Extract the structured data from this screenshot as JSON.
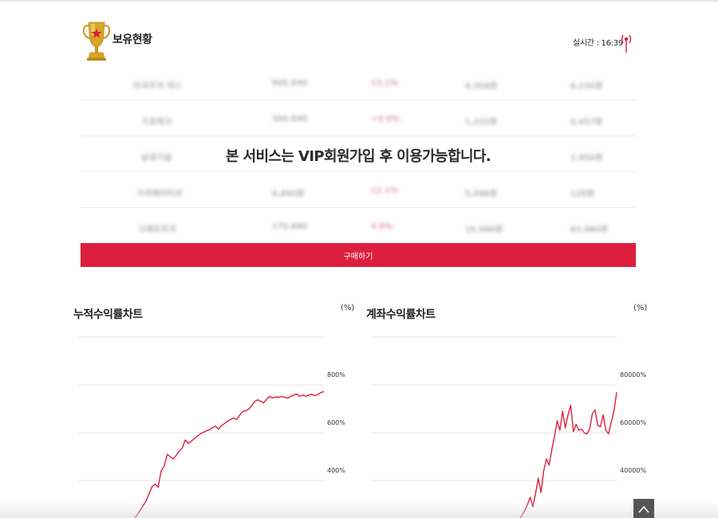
{
  "header": {
    "title": "보유현황",
    "realtime_label": "실시간 : 16:39"
  },
  "holdings": {
    "rows": [
      [
        "미국주식 마스",
        "905,640",
        "13.1%",
        "4,358원",
        "6,230원"
      ],
      [
        "기초테크",
        "300,640",
        "+4.9%",
        "1,232원",
        "0,457원"
      ],
      [
        "삼성기술",
        "",
        "",
        "",
        "1,950원"
      ],
      [
        "크리에이티브",
        "0,890원",
        "12.1%",
        "5,098원",
        "120원"
      ],
      [
        "크래프트리",
        "170,840",
        "4.8%",
        "10,980원",
        "63,980원"
      ]
    ],
    "notice": "본 서비스는 VIP회원가입 후 이용가능합니다.",
    "buy_label": "구매하기"
  },
  "charts": {
    "cumulative": {
      "title": "누적수익률차트",
      "unit": "(%)"
    },
    "account": {
      "title": "계좌수익률차트",
      "unit": "(%)"
    }
  },
  "colors": {
    "accent": "#dc1f3f",
    "line": "#dc1f3f",
    "grid": "#e5e5e5"
  },
  "icons": {
    "trophy": "trophy-icon",
    "antenna": "antenna-icon",
    "scroll_top": "chevron-up-icon"
  },
  "chart_data": [
    {
      "type": "line",
      "title": "누적수익률차트",
      "ylabel": "(%)",
      "y_ticks": [
        "800%",
        "600%",
        "400%"
      ],
      "ylim": [
        210,
        1000
      ],
      "grid": true,
      "series": [
        {
          "values": [
            240,
            255,
            275,
            295,
            315,
            345,
            375,
            385,
            372,
            440,
            460,
            510,
            500,
            490,
            505,
            525,
            535,
            570,
            555,
            565,
            575,
            585,
            595,
            602,
            608,
            612,
            620,
            628,
            615,
            630,
            638,
            648,
            655,
            662,
            655,
            672,
            688,
            692,
            698,
            712,
            730,
            738,
            732,
            725,
            740,
            752,
            745,
            750,
            748,
            752,
            748,
            745,
            752,
            758,
            762,
            752,
            758,
            752,
            758,
            760,
            755,
            760,
            768,
            772
          ]
        }
      ]
    },
    {
      "type": "line",
      "title": "계좌수익률차트",
      "ylabel": "(%)",
      "y_ticks": [
        "80000%",
        "60000%",
        "40000%"
      ],
      "ylim": [
        21000,
        100000
      ],
      "grid": true,
      "series": [
        {
          "values": [
            24000,
            25500,
            27500,
            30000,
            33000,
            29000,
            34500,
            41000,
            35000,
            44000,
            49000,
            46500,
            53000,
            58500,
            65000,
            61000,
            69000,
            62000,
            67500,
            71500,
            60500,
            63500,
            61000,
            61500,
            60000,
            59500,
            61500,
            68000,
            69500,
            63000,
            62500,
            67500,
            61000,
            59500,
            64500,
            69000,
            77000
          ]
        }
      ]
    }
  ]
}
